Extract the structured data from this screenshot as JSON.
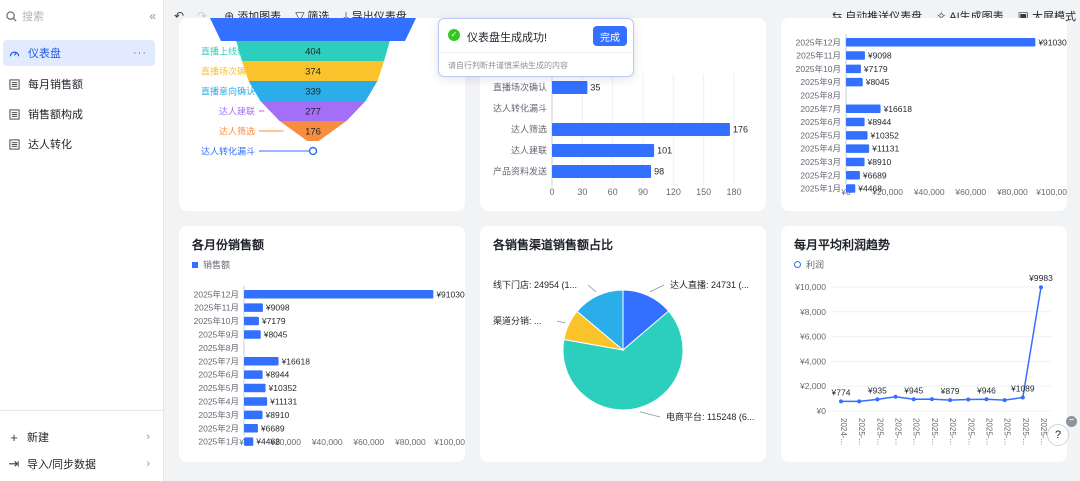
{
  "sidebar": {
    "search_placeholder": "搜索",
    "items": [
      {
        "label": "仪表盘",
        "active": true
      },
      {
        "label": "每月销售额"
      },
      {
        "label": "销售额构成"
      },
      {
        "label": "达人转化"
      }
    ],
    "more": "···",
    "new_label": "新建",
    "import_label": "导入/同步数据"
  },
  "toolbar": {
    "add_chart": "添加图表",
    "filter": "筛选",
    "export": "导出仪表盘",
    "auto_push": "自动推送仪表盘",
    "ai_generate": "AI生成图表",
    "big_screen": "大屏模式"
  },
  "toast": {
    "title": "仪表盘生成成功!",
    "done": "完成",
    "hint": "请自行判断并谨慎采纳生成的内容"
  },
  "colors": {
    "accent": "#3370ff",
    "teal": "#2ccfbd",
    "yellow": "#fac22b",
    "purple": "#a56ef7",
    "orange": "#f78e3f",
    "sky": "#2aade8",
    "line": "#3370ff"
  },
  "chart_data": [
    {
      "type": "funnel",
      "categories": [
        "直播上线售卖",
        "直播场次确认",
        "直播意向确认",
        "达人建联",
        "达人筛选",
        "达人转化漏斗"
      ],
      "values": [
        404,
        374,
        339,
        277,
        176,
        null
      ],
      "colors": [
        "#2ccfbd",
        "#fac22b",
        "#2aade8",
        "#a56ef7",
        "#f78e3f",
        "#3370ff"
      ]
    },
    {
      "type": "bar",
      "orientation": "horizontal",
      "categories": [
        "直播场次确认",
        "达人转化漏斗",
        "达人筛选",
        "达人建联",
        "产品资料发送"
      ],
      "values": [
        35,
        null,
        176,
        101,
        98
      ],
      "xticks": [
        "0",
        "30",
        "60",
        "90",
        "120",
        "150",
        "180"
      ],
      "xlim": [
        0,
        180
      ]
    },
    {
      "type": "bar",
      "orientation": "horizontal",
      "categories": [
        "2025年12月",
        "2025年11月",
        "2025年10月",
        "2025年9月",
        "2025年8月",
        "2025年7月",
        "2025年6月",
        "2025年5月",
        "2025年4月",
        "2025年3月",
        "2025年2月",
        "2025年1月"
      ],
      "values": [
        91030,
        9098,
        7179,
        8045,
        null,
        16618,
        8944,
        10352,
        11131,
        8910,
        6689,
        4468
      ],
      "labels": [
        "¥91030",
        "¥9098",
        "¥7179",
        "¥8045",
        "",
        "¥16618",
        "¥8944",
        "¥10352",
        "¥11131",
        "¥8910",
        "¥6689",
        "¥4468"
      ],
      "xticks": [
        "¥0",
        "¥20,000",
        "¥40,000",
        "¥60,000",
        "¥80,000",
        "¥100,000"
      ],
      "xlim": [
        0,
        100000
      ]
    },
    {
      "type": "bar",
      "orientation": "horizontal",
      "title": "各月份销售额",
      "legend": "销售额",
      "categories": [
        "2025年12月",
        "2025年11月",
        "2025年10月",
        "2025年9月",
        "2025年8月",
        "2025年7月",
        "2025年6月",
        "2025年5月",
        "2025年4月",
        "2025年3月",
        "2025年2月",
        "2025年1月"
      ],
      "values": [
        91030,
        9098,
        7179,
        8045,
        null,
        16618,
        8944,
        10352,
        11131,
        8910,
        6689,
        4468
      ],
      "labels": [
        "¥91030",
        "¥9098",
        "¥7179",
        "¥8045",
        "",
        "¥16618",
        "¥8944",
        "¥10352",
        "¥11131",
        "¥8910",
        "¥6689",
        "¥4468"
      ],
      "xticks": [
        "¥0",
        "¥20,000",
        "¥40,000",
        "¥60,000",
        "¥80,000",
        "¥100,000"
      ],
      "xlim": [
        0,
        100000
      ]
    },
    {
      "type": "pie",
      "title": "各销售渠道销售额占比",
      "slices": [
        {
          "name": "达人直播",
          "value": 24731,
          "label": "达人直播: 24731 (...",
          "color": "#3370ff"
        },
        {
          "name": "电商平台",
          "value": 115248,
          "label": "电商平台: 115248 (6...",
          "color": "#2ccfbd"
        },
        {
          "name": "渠道分销",
          "value": 15000,
          "label": "渠道分销: ...",
          "color": "#fac22b"
        },
        {
          "name": "线下门店",
          "value": 24954,
          "label": "线下门店: 24954 (1...",
          "color": "#2aade8"
        }
      ]
    },
    {
      "type": "line",
      "title": "每月平均利润趋势",
      "legend": "利润",
      "values": [
        774,
        774,
        935,
        1150,
        945,
        960,
        879,
        930,
        946,
        880,
        1089,
        9983
      ],
      "point_labels": [
        "¥774",
        "",
        "¥935",
        "",
        "¥945",
        "",
        "¥879",
        "",
        "¥946",
        "",
        "¥1089",
        "¥9983"
      ],
      "xticks": [
        "2024-...",
        "2025-...",
        "2025-...",
        "2025-...",
        "2025-...",
        "2025-...",
        "2025-...",
        "2025-...",
        "2025-...",
        "2025-...",
        "2025-...",
        "2025-..."
      ],
      "yticks": [
        "¥0",
        "¥2,000",
        "¥4,000",
        "¥6,000",
        "¥8,000",
        "¥10,000"
      ],
      "ylim": [
        0,
        10000
      ]
    }
  ]
}
